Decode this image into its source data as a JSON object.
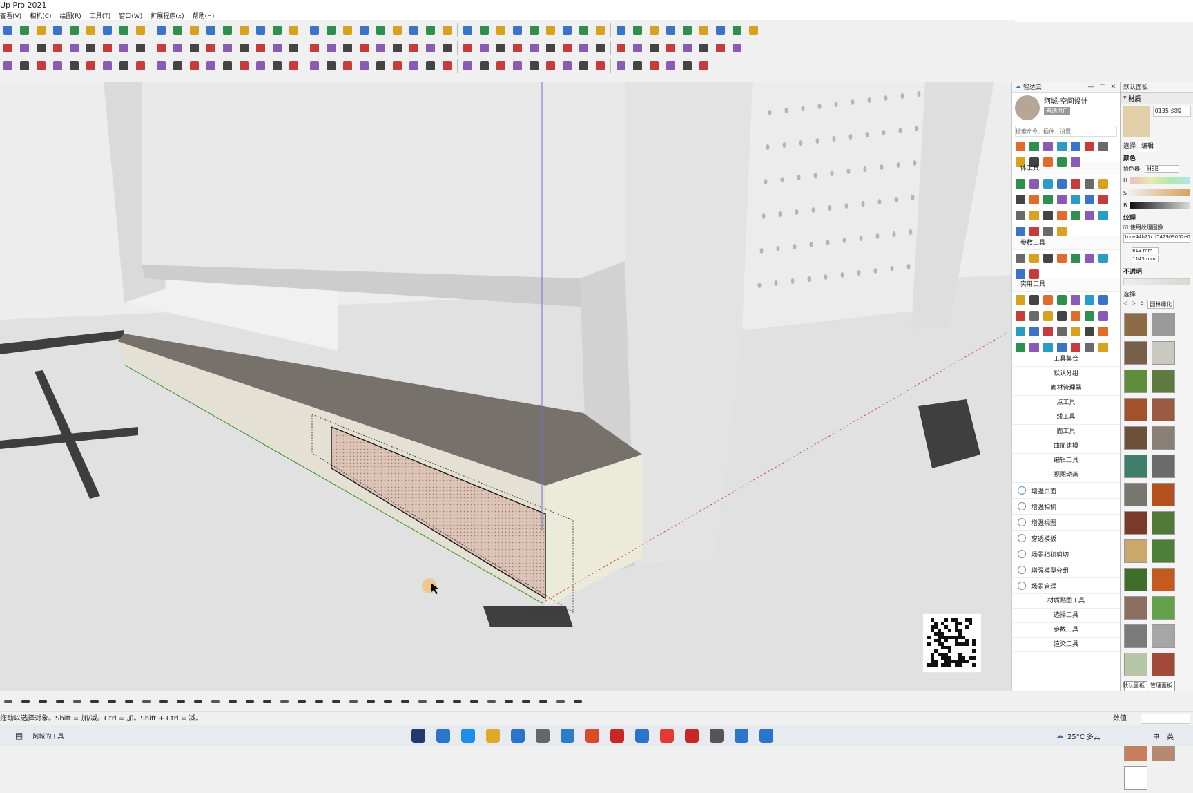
{
  "window": {
    "title": "Up Pro 2021"
  },
  "menus": [
    "查看(V)",
    "相机(C)",
    "绘图(R)",
    "工具(T)",
    "窗口(W)",
    "扩展程序(x)",
    "帮助(H)"
  ],
  "plugin_panel": {
    "title": "智达云",
    "user_name": "阿城-空间设计",
    "user_badge": "普通用户",
    "search_placeholder": "搜索命令、插件、设置...",
    "sections": {
      "body_tools": "体工具",
      "param_tools": "参数工具",
      "util_tools": "实用工具"
    },
    "menu_items": [
      "工具集合",
      "默认分组",
      "素材管理器",
      "点工具",
      "线工具",
      "面工具",
      "曲面建模",
      "编辑工具",
      "视图动画"
    ],
    "tool_items": [
      "增强页面",
      "增强相机",
      "增强视图",
      "穿透模板",
      "场景相机剪切",
      "增强模型分组",
      "场景管理"
    ],
    "bottom_items": [
      "材质贴图工具",
      "选择工具",
      "参数工具",
      "渲染工具"
    ]
  },
  "materials": {
    "panel_title": "默认面板",
    "section": "材质",
    "material_name": "0135 深胶",
    "tabs": [
      "选择",
      "编辑"
    ],
    "color_label": "颜色",
    "picker_label": "拾色器:",
    "picker_value": "HSB",
    "channels": [
      "H",
      "S",
      "B"
    ],
    "texture_label": "纹理",
    "use_texture": "使用纹理图像",
    "texture_file": "1cce44b27cd742909052e0",
    "width": "813 mm",
    "height": "1143 mm",
    "opacity_label": "不透明",
    "select_label": "选择",
    "library": "园林绿化",
    "bottom_tabs": [
      "默认面板",
      "管理面板"
    ],
    "swatch_colors": [
      "#8d6b47",
      "#9a9a9a",
      "#76604a",
      "#c9c9c1",
      "#5f8d3a",
      "#5e7a3f",
      "#a0522d",
      "#9b5b42",
      "#6d4f3a",
      "#8a7f73",
      "#3f7f6a",
      "#6b6b6b",
      "#777770",
      "#b4511f",
      "#7a3a2a",
      "#4f7a35",
      "#c8a96a",
      "#4d7f3a",
      "#3e6d2c",
      "#c45a1f",
      "#8c6e60",
      "#64a34a",
      "#7a7a7a",
      "#a6a6a6",
      "#b8c6a8",
      "#a24a3a",
      "#ffffff",
      "#8b4a2b",
      "#7e8c48",
      "#9a8f85",
      "#c57f5f",
      "#b48a70",
      "#ffffff"
    ]
  },
  "status": {
    "hint": "拖动以选择对象。Shift = 加/减。Ctrl = 加。Shift + Ctrl = 减。",
    "value_label": "数值"
  },
  "taskbar": {
    "search_text": "阿城的工具",
    "weather": "25°C 多云",
    "tray": [
      "中",
      "英"
    ]
  }
}
